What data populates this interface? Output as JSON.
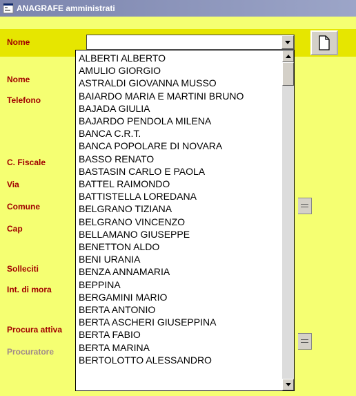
{
  "window": {
    "title": "ANAGRAFE amministrati"
  },
  "topband": {
    "nome_label": "Nome"
  },
  "labels": {
    "nome": "Nome",
    "telefono": "Telefono",
    "cfiscale": "C. Fiscale",
    "via": "Via",
    "comune": "Comune",
    "cap": "Cap",
    "solleciti": "Solleciti",
    "int_mora": "Int. di mora",
    "procura_attiva": "Procura attiva",
    "procuratore": "Procuratore"
  },
  "combo": {
    "value": "",
    "placeholder": ""
  },
  "buttons": {
    "new_tooltip": "Nuovo"
  },
  "dropdown": {
    "items": [
      "ALBERTI ALBERTO",
      "AMULIO GIORGIO",
      "ASTRALDI GIOVANNA MUSSO",
      "BAIARDO MARIA E MARTINI BRUNO",
      "BAJADA GIULIA",
      "BAJARDO PENDOLA MILENA",
      "BANCA C.R.T.",
      "BANCA POPOLARE DI NOVARA",
      "BASSO RENATO",
      "BASTASIN CARLO E PAOLA",
      "BATTEL RAIMONDO",
      "BATTISTELLA LOREDANA",
      "BELGRANO TIZIANA",
      "BELGRANO VINCENZO",
      "BELLAMANO GIUSEPPE",
      "BENETTON ALDO",
      "BENI URANIA",
      "BENZA ANNAMARIA",
      "BEPPINA",
      "BERGAMINI MARIO",
      "BERTA ANTONIO",
      "BERTA ASCHERI GIUSEPPINA",
      "BERTA FABIO",
      "BERTA MARINA",
      "BERTOLOTTO ALESSANDRO"
    ]
  }
}
